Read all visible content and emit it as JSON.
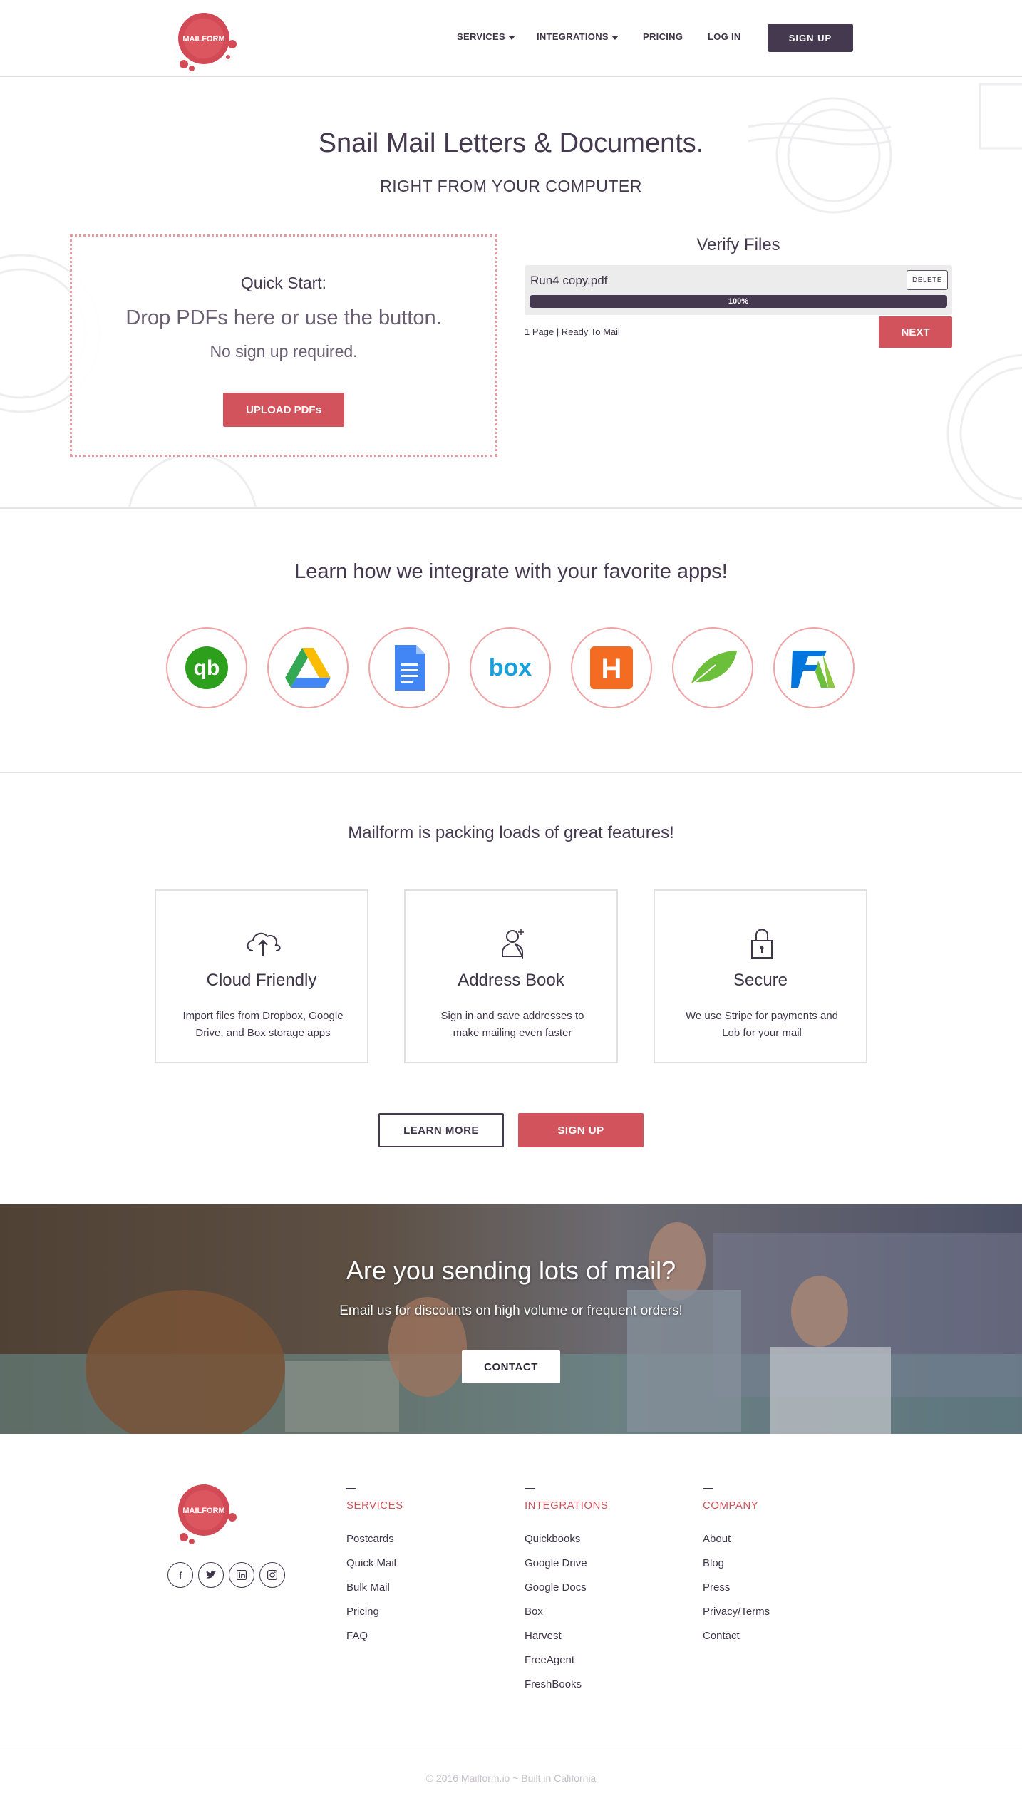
{
  "header": {
    "logo_text": "MAILFORM",
    "nav": {
      "services": "SERVICES",
      "integrations": "INTEGRATIONS",
      "pricing": "PRICING",
      "login": "LOG IN",
      "signup": "SIGN UP"
    }
  },
  "hero": {
    "title": "Snail Mail Letters & Documents.",
    "subtitle": "RIGHT FROM YOUR COMPUTER",
    "dropzone": {
      "heading": "Quick Start:",
      "instruction": "Drop PDFs here or use the button.",
      "note": "No sign up required.",
      "upload_label": "UPLOAD PDFs"
    },
    "verify": {
      "title": "Verify Files",
      "file_name": "Run4 copy.pdf",
      "delete_label": "DELETE",
      "progress_label": "100%",
      "progress_value": 100,
      "status": "1 Page | Ready To Mail",
      "next_label": "NEXT"
    }
  },
  "integrations": {
    "title": "Learn how we integrate with your favorite apps!",
    "apps": [
      {
        "name": "quickbooks-icon"
      },
      {
        "name": "google-drive-icon"
      },
      {
        "name": "google-docs-icon"
      },
      {
        "name": "box-icon",
        "text": "box"
      },
      {
        "name": "harvest-icon",
        "text": "H"
      },
      {
        "name": "freeagent-icon"
      },
      {
        "name": "freshbooks-icon"
      }
    ]
  },
  "features": {
    "title": "Mailform is packing loads of great features!",
    "items": [
      {
        "icon": "cloud-upload-icon",
        "title": "Cloud Friendly",
        "desc": "Import files from Dropbox, Google Drive, and Box storage apps"
      },
      {
        "icon": "add-user-icon",
        "title": "Address Book",
        "desc": "Sign in and save addresses to make mailing even faster"
      },
      {
        "icon": "lock-icon",
        "title": "Secure",
        "desc": "We use Stripe for payments and Lob for your mail"
      }
    ],
    "learn_more_label": "LEARN MORE",
    "signup_label": "SIGN UP"
  },
  "banner": {
    "title": "Are you sending lots of mail?",
    "subtitle": "Email us for discounts on high volume or frequent orders!",
    "contact_label": "CONTACT"
  },
  "footer": {
    "logo_text": "MAILFORM",
    "social": [
      "facebook-icon",
      "twitter-icon",
      "linkedin-icon",
      "instagram-icon"
    ],
    "columns": [
      {
        "heading": "SERVICES",
        "links": [
          "Postcards",
          "Quick Mail",
          "Bulk Mail",
          "Pricing",
          "FAQ"
        ]
      },
      {
        "heading": "INTEGRATIONS",
        "links": [
          "Quickbooks",
          "Google Drive",
          "Google Docs",
          "Box",
          "Harvest",
          "FreeAgent",
          "FreshBooks"
        ]
      },
      {
        "heading": "COMPANY",
        "links": [
          "About",
          "Blog",
          "Press",
          "Privacy/Terms",
          "Contact"
        ]
      }
    ],
    "copyright": "© 2016 Mailform.io ~ Built in California"
  },
  "colors": {
    "primary_dark": "#45394f",
    "accent_red": "#d2535c",
    "border_light": "#e2e2e2"
  }
}
